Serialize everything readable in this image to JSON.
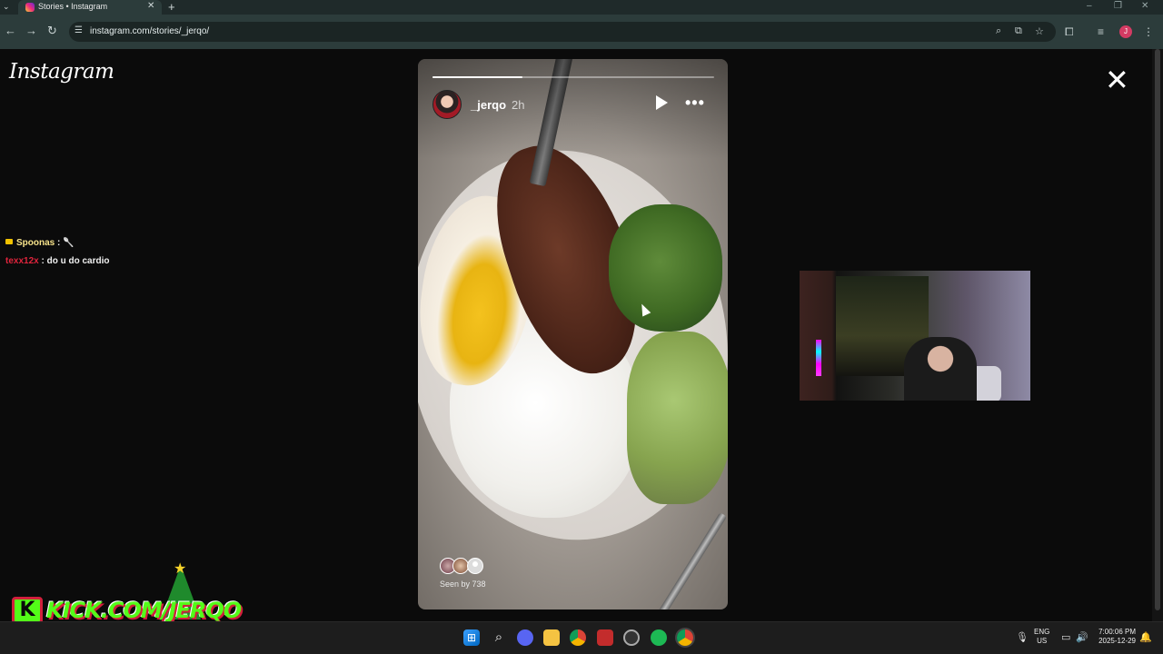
{
  "browser": {
    "tab_title": "Stories • Instagram",
    "tab_close": "✕",
    "tab_list": "⌄",
    "new_tab": "+",
    "url": "instagram.com/stories/_jerqo/",
    "window_controls": [
      "–",
      "❐",
      "✕"
    ],
    "nav_icons": {
      "back": "←",
      "forward": "→",
      "reload": "↻"
    },
    "omnibox_icons": [
      "zoom-icon",
      "cast-icon",
      "bookmark-star-icon"
    ],
    "toolbar_icons": [
      "extensions-icon",
      "media-icon"
    ],
    "profile_initial": "J"
  },
  "instagram": {
    "logo": "Instagram",
    "close_label": "✕",
    "story": {
      "username": "_jerqo",
      "time_ago": "2h",
      "progress_fraction": 0.32,
      "more_label": "•••",
      "seen_by": "Seen by 738"
    }
  },
  "chat": [
    {
      "user": "Spoonas",
      "separator": " : ",
      "message": "🥄",
      "user_color": "#f7e38b"
    },
    {
      "user": "texx12x",
      "separator": " : ",
      "message": "do u do cardio",
      "user_color": "#e0243c"
    }
  ],
  "branding": {
    "kick_letter": "K",
    "kick_text": "KICK.COM/JERQO",
    "star": "★"
  },
  "taskbar": {
    "apps": [
      "start-icon",
      "search-icon",
      "discord-icon",
      "file-explorer-icon",
      "chrome-icon",
      "stream-app-icon",
      "apps-icon",
      "spotify-icon",
      "chrome-icon"
    ],
    "search_glyph": "⌕",
    "lang_top": "ENG",
    "lang_bottom": "US",
    "time": "7:00:06 PM",
    "date": "2025-12-29"
  },
  "colors": {
    "kick_green": "#53fc18",
    "kick_red": "#d11f3c",
    "chrome_toolbar": "#2c3c3b"
  }
}
